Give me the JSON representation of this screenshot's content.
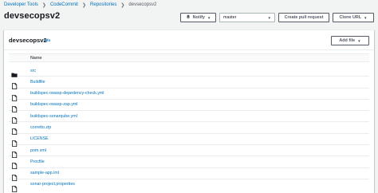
{
  "breadcrumb": {
    "items": [
      "Developer Tools",
      "CodeCommit",
      "Repositories"
    ],
    "current": "devsecopsv2"
  },
  "page": {
    "title": "devsecopsv2"
  },
  "actions": {
    "notify_label": "Notify",
    "branch_value": "master",
    "pull_request_label": "Create pull request",
    "clone_label": "Clone URL"
  },
  "panel": {
    "title": "devsecopsv2",
    "info_label": "Info",
    "add_file_label": "Add file",
    "column_name": "Name"
  },
  "files": [
    {
      "name": "src",
      "type": "folder"
    },
    {
      "name": "Buildfile",
      "type": "file"
    },
    {
      "name": "buildspec-owasp-depedency-check.yml",
      "type": "file"
    },
    {
      "name": "buildspec-owasp-zap.yml",
      "type": "file"
    },
    {
      "name": "buildspec-sonarqube.yml",
      "type": "file"
    },
    {
      "name": "corretto.zip",
      "type": "file"
    },
    {
      "name": "LICENSE",
      "type": "file"
    },
    {
      "name": "pom.xml",
      "type": "file"
    },
    {
      "name": "Procfile",
      "type": "file"
    },
    {
      "name": "sample-app.iml",
      "type": "file"
    },
    {
      "name": "sonar-project.properties",
      "type": "file"
    }
  ],
  "colors": {
    "link": "#0073bb",
    "background": "#f2f3f3",
    "border": "#eaeded"
  }
}
